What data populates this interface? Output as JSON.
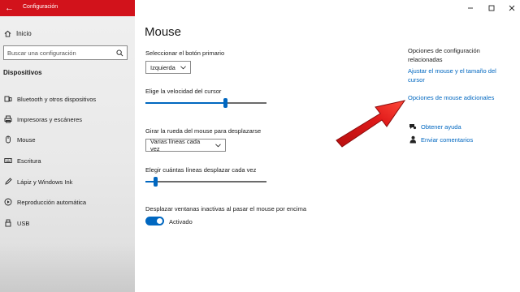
{
  "window": {
    "app_title": "Configuración",
    "controls": [
      "minimize-icon",
      "maximize-icon",
      "close-icon"
    ]
  },
  "sidebar": {
    "home_label": "Inicio",
    "search_placeholder": "Buscar una configuración",
    "section_title": "Dispositivos",
    "items": [
      {
        "label": "Bluetooth y otros dispositivos",
        "icon": "bluetooth-icon"
      },
      {
        "label": "Impresoras y escáneres",
        "icon": "printer-icon"
      },
      {
        "label": "Mouse",
        "icon": "mouse-icon"
      },
      {
        "label": "Escritura",
        "icon": "keyboard-icon"
      },
      {
        "label": "Lápiz y Windows Ink",
        "icon": "pen-icon"
      },
      {
        "label": "Reproducción automática",
        "icon": "autoplay-icon"
      },
      {
        "label": "USB",
        "icon": "usb-icon"
      }
    ]
  },
  "main": {
    "title": "Mouse",
    "primary_button_label": "Seleccionar el botón primario",
    "primary_button_value": "Izquierda",
    "cursor_speed_label": "Elige la velocidad del cursor",
    "cursor_speed_level": 0.67,
    "scroll_wheel_label": "Girar la rueda del mouse para desplazarse",
    "scroll_wheel_value": "Varias líneas cada vez",
    "lines_label": "Elegir cuántas líneas desplazar cada vez",
    "lines_level": 0.07,
    "inactive_scroll_label": "Desplazar ventanas inactivas al pasar el mouse por encima",
    "inactive_scroll_state": "Activado",
    "inactive_scroll_on": true
  },
  "related": {
    "title": "Opciones de configuración relacionadas",
    "link_adjust": "Ajustar el mouse y el tamaño del cursor",
    "link_additional": "Opciones de mouse adicionales",
    "help_label": "Obtener ayuda",
    "feedback_label": "Enviar comentarios"
  },
  "colors": {
    "accent": "#0067c0",
    "title_strip": "#d2121b",
    "annotation_arrow": "#e01a1a"
  }
}
